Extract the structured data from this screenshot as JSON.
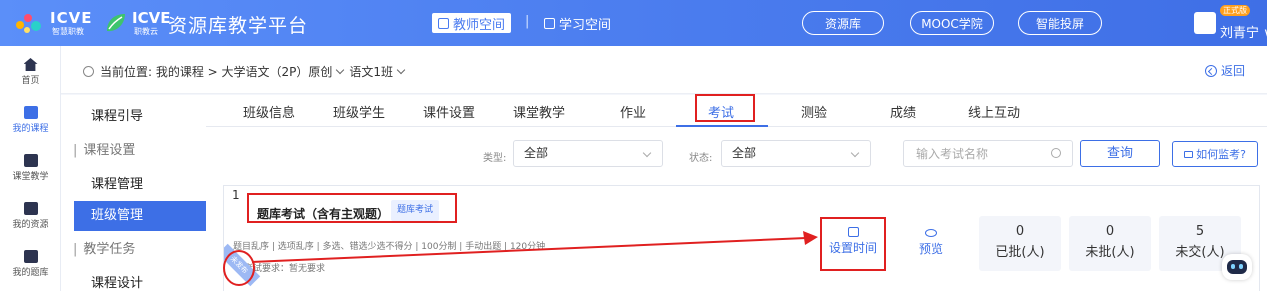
{
  "header": {
    "logo1_text": "ICVE",
    "logo1_sub": "智慧职教",
    "logo2_text": "ICVE",
    "logo2_sub": "职教云",
    "platform_title": "资源库教学平台",
    "teacher_space": "教师空间",
    "separator": "|",
    "student_space": "学习空间",
    "pills": [
      "资源库",
      "MOOC学院",
      "智能投屏"
    ],
    "user_badge": "正式版",
    "user_name": "刘青宁 ∨"
  },
  "rail": {
    "items": [
      {
        "label": "首页",
        "icon": "home-icon"
      },
      {
        "label": "我的课程",
        "icon": "course-icon"
      },
      {
        "label": "课堂教学",
        "icon": "classroom-icon"
      },
      {
        "label": "我的资源",
        "icon": "resource-icon"
      },
      {
        "label": "我的题库",
        "icon": "question-bank-icon"
      }
    ],
    "active": "我的课程"
  },
  "breadcrumb": {
    "prefix": "当前位置: 我的课程 > 大学语文（2P）原创",
    "class_name": "语文1班",
    "back_label": "返回"
  },
  "side_menu": {
    "items": [
      {
        "label": "课程引导",
        "type": "item"
      },
      {
        "label": "课程设置",
        "type": "group"
      },
      {
        "label": "课程管理",
        "type": "item"
      },
      {
        "label": "班级管理",
        "type": "item",
        "active": true
      },
      {
        "label": "教学任务",
        "type": "group"
      },
      {
        "label": "课程设计",
        "type": "item"
      }
    ]
  },
  "tabs": {
    "items": [
      "班级信息",
      "班级学生",
      "课件设置",
      "课堂教学",
      "作业",
      "考试",
      "测验",
      "成绩",
      "线上互动"
    ],
    "active": "考试"
  },
  "filters": {
    "type_label": "类型:",
    "type_value": "全部",
    "status_label": "状态:",
    "status_value": "全部",
    "search_placeholder": "输入考试名称",
    "query_button": "查询",
    "monitor_button": "如何监考?"
  },
  "exam_card": {
    "index": "1",
    "title": "题库考试（含有主观题）",
    "tag": "题库考试",
    "meta": "题目乱序 | 选项乱序 | 多选、错选少选不得分 | 100分制 | 手动出题 | 120分钟",
    "requirement": "考试要求：暂无要求",
    "corner_badge": "未发布",
    "actions": [
      {
        "label": "设置时间",
        "icon": "upload-icon"
      },
      {
        "label": "预览",
        "icon": "eye-icon"
      }
    ],
    "stats": [
      {
        "value": "0",
        "label": "已批(人)"
      },
      {
        "value": "0",
        "label": "未批(人)"
      },
      {
        "value": "5",
        "label": "未交(人)"
      }
    ]
  },
  "colors": {
    "primary": "#3d6fe6",
    "header_blue": "#4d7ff0",
    "annotation_red": "#e02020"
  }
}
